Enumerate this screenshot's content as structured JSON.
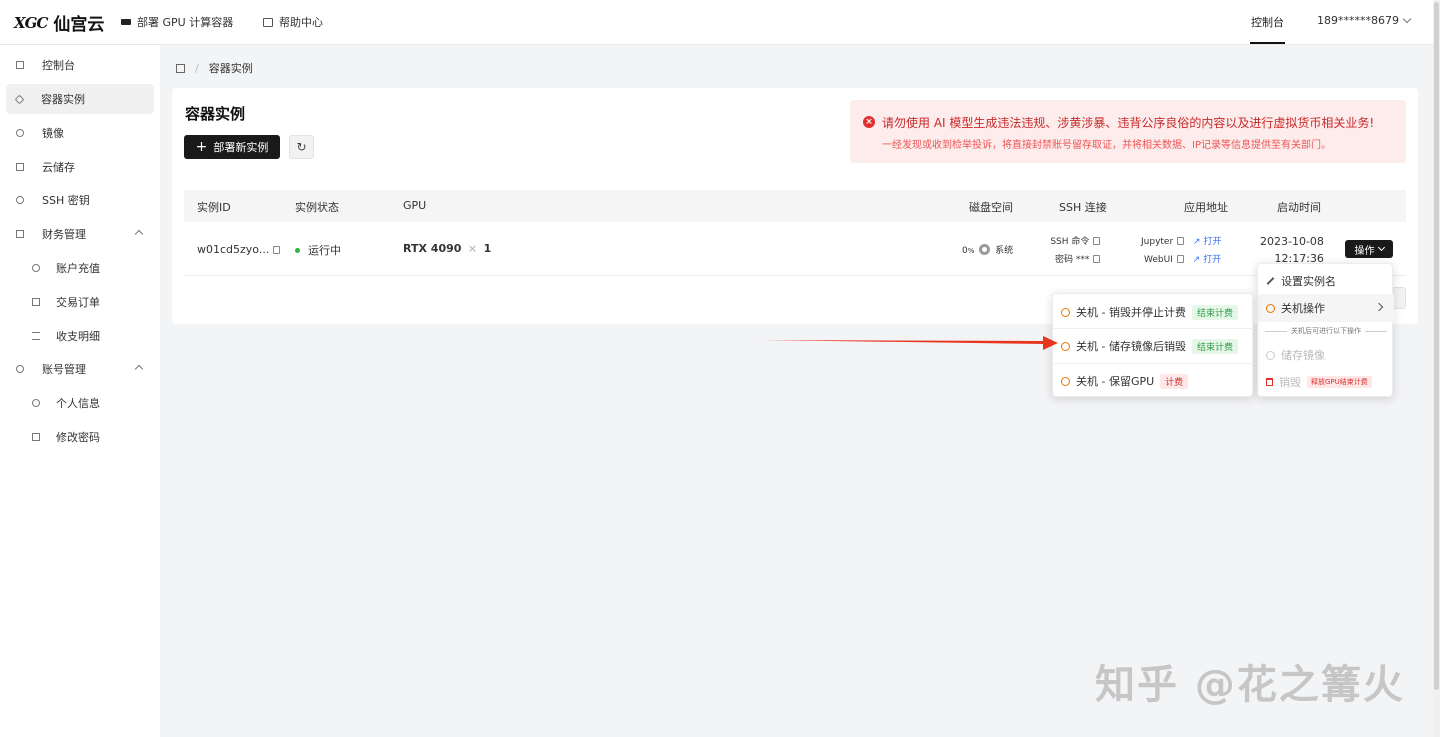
{
  "brand": {
    "logo_mark": "XGC",
    "name": "仙宫云"
  },
  "topnav": {
    "deploy_label": "部署 GPU 计算容器",
    "help_label": "帮助中心",
    "console_label": "控制台",
    "user": "189******8679"
  },
  "sidebar": {
    "items": [
      {
        "label": "控制台",
        "icon": "dashboard-icon"
      },
      {
        "label": "容器实例",
        "icon": "container-icon",
        "active": true
      },
      {
        "label": "镜像",
        "icon": "image-icon"
      },
      {
        "label": "云储存",
        "icon": "storage-icon"
      },
      {
        "label": "SSH 密钥",
        "icon": "key-icon"
      },
      {
        "label": "财务管理",
        "icon": "finance-icon",
        "expandable": true
      },
      {
        "label": "账户充值",
        "icon": "recharge-icon",
        "sub": true
      },
      {
        "label": "交易订单",
        "icon": "order-icon",
        "sub": true
      },
      {
        "label": "收支明细",
        "icon": "list-icon",
        "sub": true
      },
      {
        "label": "账号管理",
        "icon": "account-icon",
        "expandable": true
      },
      {
        "label": "个人信息",
        "icon": "user-icon",
        "sub": true
      },
      {
        "label": "修改密码",
        "icon": "lock-icon",
        "sub": true
      }
    ]
  },
  "breadcrumb": {
    "current": "容器实例"
  },
  "page": {
    "title": "容器实例",
    "deploy_button": "部署新实例",
    "refresh_icon": "refresh-icon"
  },
  "alert": {
    "title": "请勿使用 AI 模型生成违法违规、涉黄涉暴、违背公序良俗的内容以及进行虚拟货币相关业务!",
    "subtitle": "一经发现或收到检举投诉，将直接封禁账号留存取证，并将相关数据、IP记录等信息提供至有关部门。",
    "color": "#e03131"
  },
  "table": {
    "headers": {
      "id": "实例ID",
      "status": "实例状态",
      "gpu": "GPU",
      "disk": "磁盘空间",
      "ssh": "SSH 连接",
      "app": "应用地址",
      "start": "启动时间"
    },
    "row": {
      "id": "w01cd5zyo...",
      "status": "运行中",
      "status_color": "#2fb344",
      "gpu_model": "RTX 4090",
      "gpu_times": "×",
      "gpu_count": "1",
      "disk_percent": "0",
      "disk_unit": "%",
      "disk_label": "系统",
      "ssh_cmd": "SSH 命令",
      "ssh_pwd": "密码 ***",
      "app_jupyter": "Jupyter",
      "app_webui": "WebUI",
      "open_label": "打开",
      "start_date": "2023-10-08",
      "start_time": "12:17:36",
      "ops_button": "操作"
    }
  },
  "ops_menu": {
    "rename": "设置实例名",
    "shutdown_ops": "关机操作",
    "hint": "关机后可进行以下操作",
    "save_image": "储存镜像",
    "destroy": "销毁",
    "destroy_tag": "释放GPU结束计费"
  },
  "shutdown_menu": {
    "items": [
      {
        "label": "关机 - 销毁并停止计费",
        "tag": "结束计费",
        "tag_type": "green"
      },
      {
        "label": "关机 - 储存镜像后销毁",
        "tag": "结束计费",
        "tag_type": "green"
      },
      {
        "label": "关机 - 保留GPU",
        "tag": "计费",
        "tag_type": "red"
      }
    ]
  },
  "annotation": {
    "arrow_color": "#e8351f"
  },
  "watermark": "知乎 @花之篝火"
}
